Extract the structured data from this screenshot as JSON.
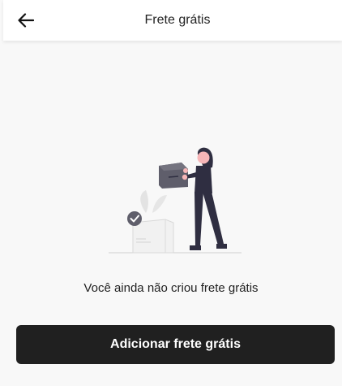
{
  "header": {
    "back_icon": "arrow-left-icon",
    "title": "Frete grátis"
  },
  "empty_state": {
    "message": "Você ainda não criou frete grátis"
  },
  "actions": {
    "add_label": "Adicionar frete grátis"
  },
  "colors": {
    "background": "#f8f8f8",
    "primary_button": "#202020",
    "text": "#222222",
    "accent_pink": "#f7b6b8",
    "illustration_dark": "#2f2e41",
    "box_gray": "#5f5e6b"
  }
}
